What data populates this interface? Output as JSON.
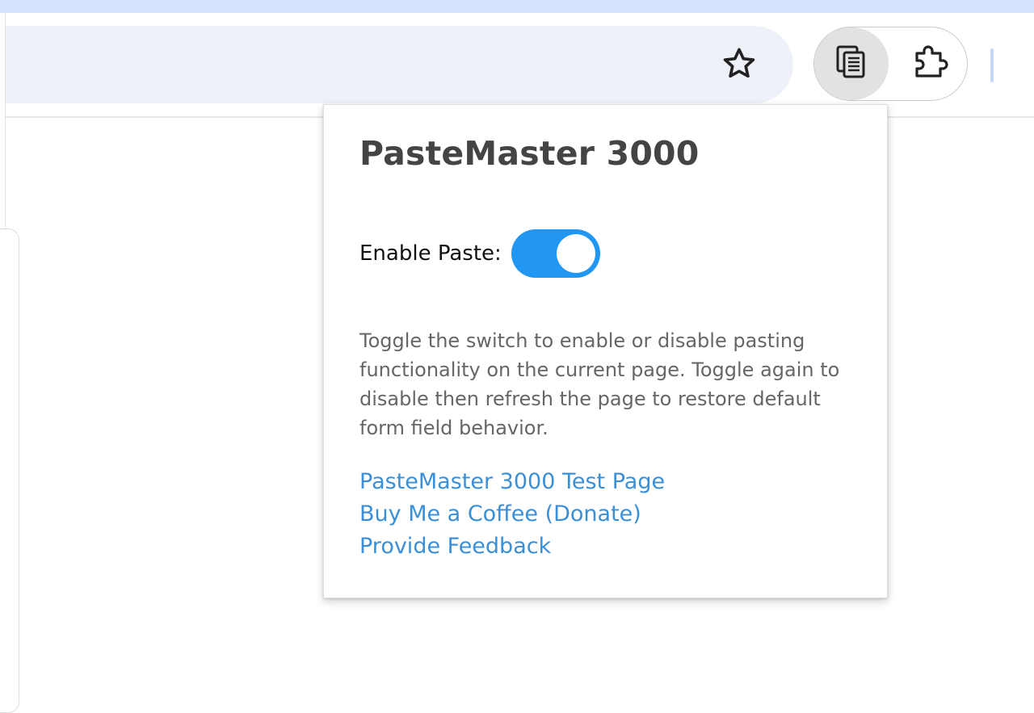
{
  "toolbar": {
    "bookmark_icon": "star-outline-icon",
    "active_extension_icon": "clipboard-copy-icon",
    "extensions_menu_icon": "puzzle-piece-icon"
  },
  "popup": {
    "title": "PasteMaster 3000",
    "toggle": {
      "label": "Enable Paste:",
      "enabled": true,
      "accent_color": "#2196f3"
    },
    "description": "Toggle the switch to enable or disable pasting functionality on the current page. Toggle again to disable then refresh the page to restore default form field behavior.",
    "links": [
      {
        "label": "PasteMaster 3000 Test Page"
      },
      {
        "label": "Buy Me a Coffee (Donate)"
      },
      {
        "label": "Provide Feedback"
      }
    ],
    "link_color": "#3a8fd6"
  },
  "colors": {
    "top_strip": "#d3e3fd",
    "omnibox": "#eef2f8",
    "title_text": "#444444"
  }
}
